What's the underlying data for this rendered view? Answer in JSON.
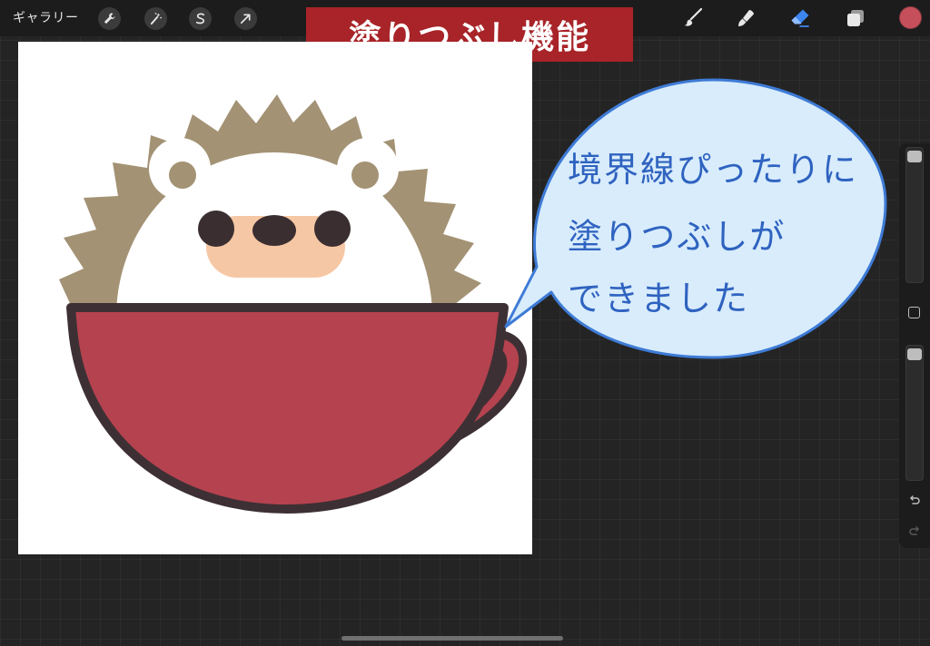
{
  "topbar": {
    "gallery_label": "ギャラリー",
    "left_tools": [
      "wrench-icon",
      "magic-wand-icon",
      "selection-s-icon",
      "transform-arrow-icon"
    ],
    "right_tools": [
      "brush-icon",
      "smudge-icon",
      "eraser-icon",
      "layers-icon"
    ],
    "active_tool": "eraser-icon",
    "current_color": "#c5505b"
  },
  "title_banner": "塗りつぶし機能",
  "speech_bubble": {
    "lines": [
      "境界線ぴったりに",
      "塗りつぶしが",
      "できました"
    ]
  },
  "colors": {
    "banner_red": "#a82428",
    "cup_red": "#b5424f",
    "outline": "#3d3034",
    "spikes": "#a39274",
    "face": "#ffffff",
    "blush": "#f6c7a4",
    "bubble_fill": "#d8ecfc",
    "bubble_stroke": "#3e7bd6",
    "bubble_text": "#2f63c0"
  },
  "sidebar": {
    "brush_size_level": 0.05,
    "opacity_level": 0.05,
    "icons": [
      "modify-square-icon",
      "undo-icon",
      "redo-icon"
    ]
  }
}
